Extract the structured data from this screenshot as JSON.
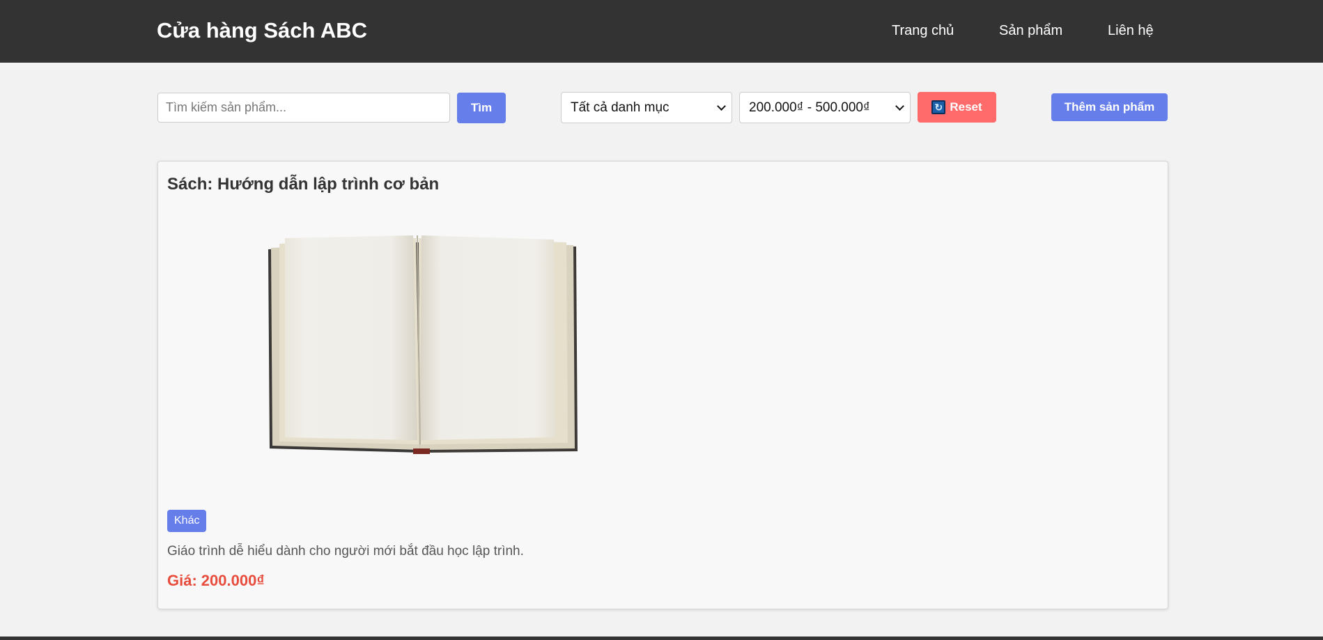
{
  "header": {
    "title": "Cửa hàng Sách ABC",
    "nav": [
      {
        "label": "Trang chủ"
      },
      {
        "label": "Sản phẩm"
      },
      {
        "label": "Liên hệ"
      }
    ]
  },
  "toolbar": {
    "search_placeholder": "Tìm kiếm sản phẩm...",
    "search_value": "",
    "search_button": "Tìm",
    "category_select": "Tất cả danh mục",
    "price_select": "200.000₫ - 500.000₫",
    "reset_button": "Reset",
    "reset_icon": "refresh-icon",
    "add_button": "Thêm sản phẩm"
  },
  "product": {
    "title": "Sách: Hướng dẫn lập trình cơ bản",
    "image_icon": "open-book",
    "category": "Khác",
    "description": "Giáo trình dễ hiểu dành cho người mới bắt đầu học lập trình.",
    "price_label": "Giá:",
    "price": "200.000₫"
  },
  "colors": {
    "header_bg": "#333333",
    "accent": "#667eea",
    "reset": "#ff6b6b",
    "price": "#e74c3c"
  }
}
